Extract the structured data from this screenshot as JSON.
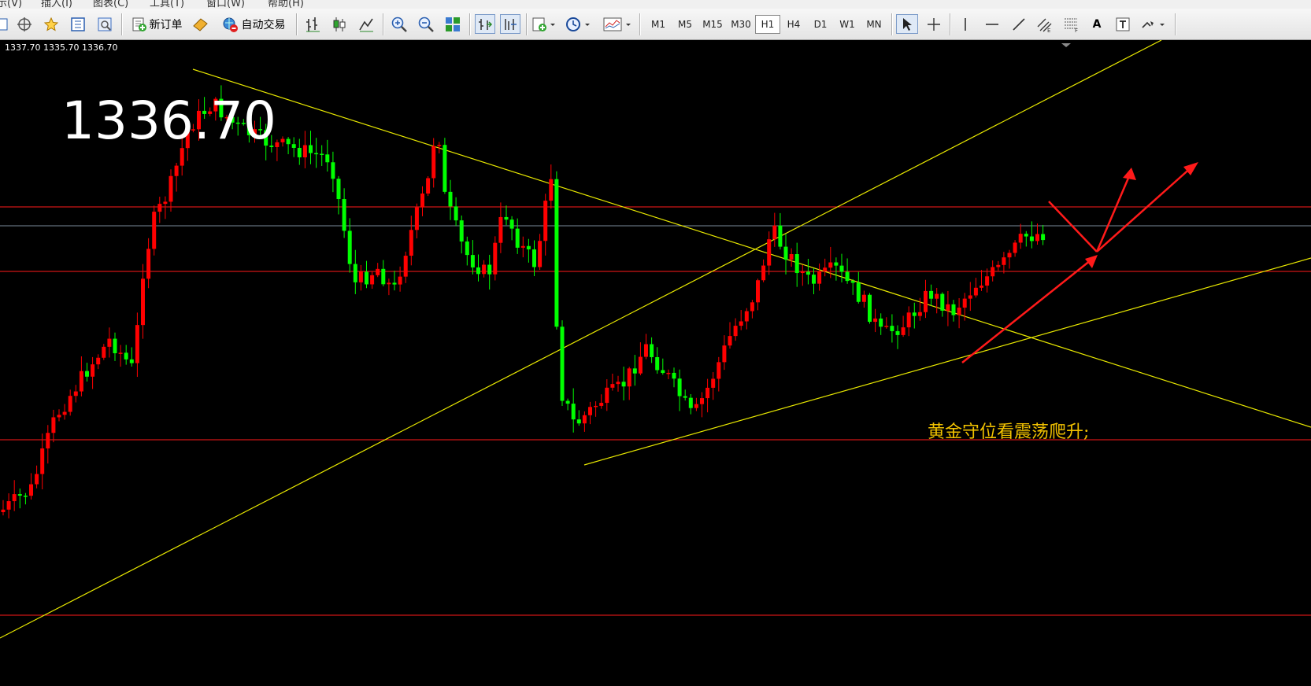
{
  "menu": {
    "items": [
      "示(V)",
      "插入(I)",
      "图表(C)",
      "工具(T)",
      "窗口(W)",
      "帮助(H)"
    ]
  },
  "toolbar": {
    "new_order_label": "新订单",
    "auto_trade_label": "自动交易",
    "timeframes": [
      "M1",
      "M5",
      "M15",
      "M30",
      "H1",
      "H4",
      "D1",
      "W1",
      "MN"
    ],
    "active_timeframe": "H1",
    "text_tool_label": "A"
  },
  "chart": {
    "ohlc_readout": "1337.70 1335.70 1336.70",
    "big_price": "1336.70",
    "annotation": "黄金守位看震荡爬升;",
    "colors": {
      "background": "#000000",
      "bull_candle": "#ff0000",
      "bear_candle": "#00ff00",
      "trendline": "#ffff00",
      "level_line": "#ff0000",
      "price_line": "#8899aa",
      "arrow": "#ff0000",
      "annotation": "#f2c200"
    },
    "axis_note": "no price axis visible"
  }
}
